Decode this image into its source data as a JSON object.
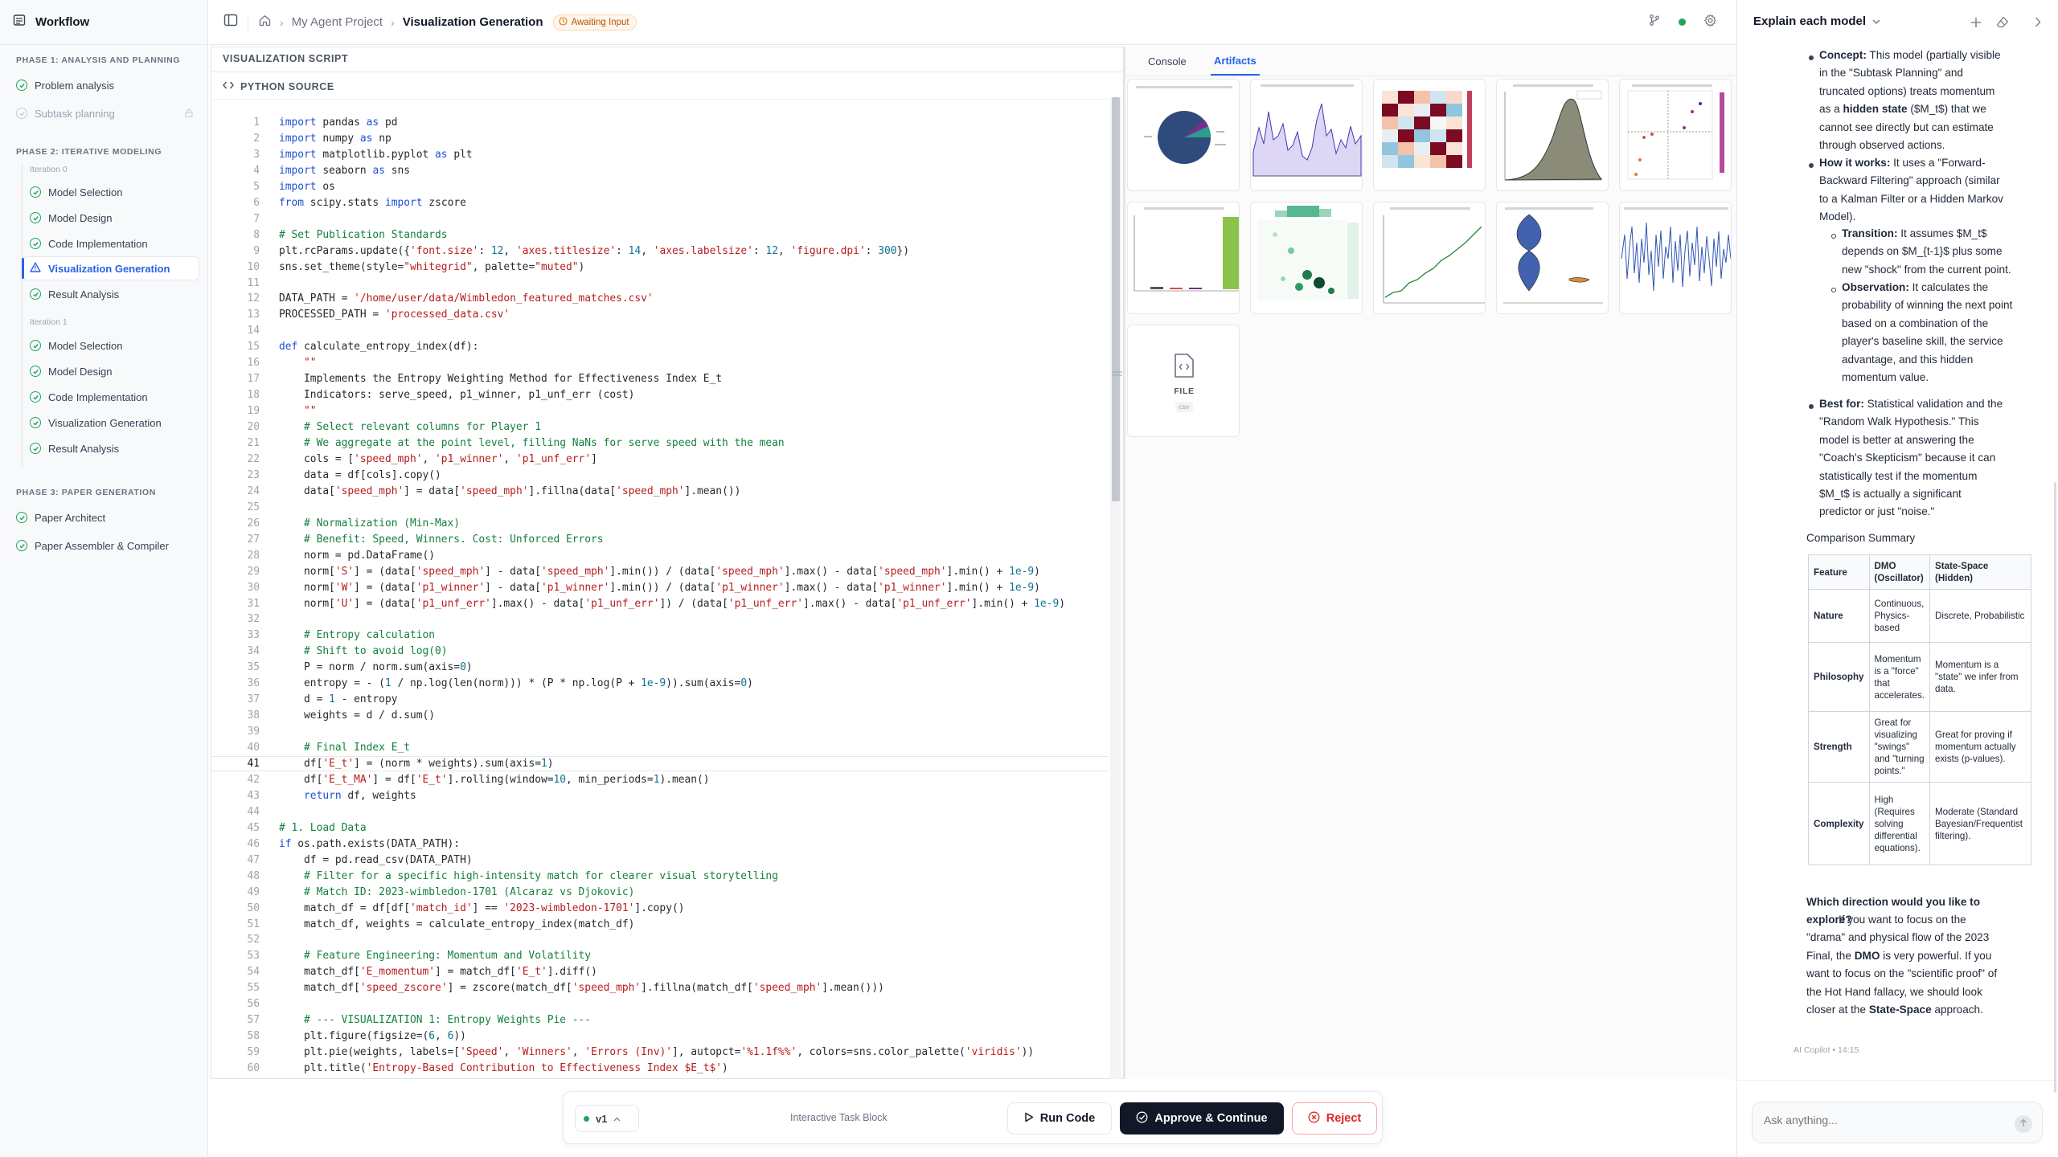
{
  "sidebar": {
    "title": "Workflow",
    "phases": [
      {
        "label": "PHASE 1: ANALYSIS AND PLANNING"
      },
      {
        "label": "PHASE 2: ITERATIVE MODELING"
      },
      {
        "label": "PHASE 3: PAPER GENERATION"
      }
    ],
    "phase1_items": [
      "Problem analysis",
      "Subtask planning"
    ],
    "iteration0_label": "Iteration 0",
    "iteration0_items": [
      "Model Selection",
      "Model Design",
      "Code Implementation",
      "Visualization Generation",
      "Result Analysis"
    ],
    "iteration1_label": "Iteration 1",
    "iteration1_items": [
      "Model Selection",
      "Model Design",
      "Code Implementation",
      "Visualization Generation",
      "Result Analysis"
    ],
    "phase3_items": [
      "Paper Architect",
      "Paper Assembler & Compiler"
    ]
  },
  "breadcrumb": {
    "project": "My Agent Project",
    "current": "Visualization Generation",
    "status": "Awaiting Input"
  },
  "editor": {
    "section_title": "VISUALIZATION SCRIPT",
    "source_label": "PYTHON SOURCE"
  },
  "code_lines": [
    "import pandas as pd",
    "import numpy as np",
    "import matplotlib.pyplot as plt",
    "import seaborn as sns",
    "import os",
    "from scipy.stats import zscore",
    "",
    "# Set Publication Standards",
    "plt.rcParams.update({'font.size': 12, 'axes.titlesize': 14, 'axes.labelsize': 12, 'figure.dpi': 300})",
    "sns.set_theme(style=\"whitegrid\", palette=\"muted\")",
    "",
    "DATA_PATH = '/home/user/data/Wimbledon_featured_matches.csv'",
    "PROCESSED_PATH = 'processed_data.csv'",
    "",
    "def calculate_entropy_index(df):",
    "    \"\"\"",
    "    Implements the Entropy Weighting Method for Effectiveness Index E_t",
    "    Indicators: serve_speed, p1_winner, p1_unf_err (cost)",
    "    \"\"\"",
    "    # Select relevant columns for Player 1",
    "    # We aggregate at the point level, filling NaNs for serve speed with the mean",
    "    cols = ['speed_mph', 'p1_winner', 'p1_unf_err']",
    "    data = df[cols].copy()",
    "    data['speed_mph'] = data['speed_mph'].fillna(data['speed_mph'].mean())",
    "",
    "    # Normalization (Min-Max)",
    "    # Benefit: Speed, Winners. Cost: Unforced Errors",
    "    norm = pd.DataFrame()",
    "    norm['S'] = (data['speed_mph'] - data['speed_mph'].min()) / (data['speed_mph'].max() - data['speed_mph'].min() + 1e-9)",
    "    norm['W'] = (data['p1_winner'] - data['p1_winner'].min()) / (data['p1_winner'].max() - data['p1_winner'].min() + 1e-9)",
    "    norm['U'] = (data['p1_unf_err'].max() - data['p1_unf_err']) / (data['p1_unf_err'].max() - data['p1_unf_err'].min() + 1e-9)",
    "",
    "    # Entropy calculation",
    "    # Shift to avoid log(0)",
    "    P = norm / norm.sum(axis=0)",
    "    entropy = - (1 / np.log(len(norm))) * (P * np.log(P + 1e-9)).sum(axis=0)",
    "    d = 1 - entropy",
    "    weights = d / d.sum()",
    "",
    "    # Final Index E_t",
    "    df['E_t'] = (norm * weights).sum(axis=1)",
    "    df['E_t_MA'] = df['E_t'].rolling(window=10, min_periods=1).mean()",
    "    return df, weights",
    "",
    "# 1. Load Data",
    "if os.path.exists(DATA_PATH):",
    "    df = pd.read_csv(DATA_PATH)",
    "    # Filter for a specific high-intensity match for clearer visual storytelling",
    "    # Match ID: 2023-wimbledon-1701 (Alcaraz vs Djokovic)",
    "    match_df = df[df['match_id'] == '2023-wimbledon-1701'].copy()",
    "    match_df, weights = calculate_entropy_index(match_df)",
    "",
    "    # Feature Engineering: Momentum and Volatility",
    "    match_df['E_momentum'] = match_df['E_t'].diff()",
    "    match_df['speed_zscore'] = zscore(match_df['speed_mph'].fillna(match_df['speed_mph'].mean()))",
    "",
    "    # --- VISUALIZATION 1: Entropy Weights Pie ---",
    "    plt.figure(figsize=(6, 6))",
    "    plt.pie(weights, labels=['Speed', 'Winners', 'Errors (Inv)'], autopct='%1.1f%%', colors=sns.color_palette('viridis'))",
    "    plt.title('Entropy-Based Contribution to Effectiveness Index $E_t$')"
  ],
  "artifacts": {
    "tabs": [
      "Console",
      "Artifacts"
    ],
    "active_tab": "Artifacts",
    "file_label": "FILE",
    "file_ext": "csv"
  },
  "chat": {
    "title": "Explain each model",
    "concept_label": "Concept:",
    "concept_text_1": " This model (partially visible",
    "concept_text_2": "in the \"Subtask Planning\" and",
    "concept_text_3": "truncated options) treats momentum",
    "concept_text_4a": "as a ",
    "concept_text_4b": "hidden state",
    "concept_text_4c": " ($M_t$) that we",
    "concept_text_5": "cannot see directly but can estimate",
    "concept_text_6": "through observed actions.",
    "how_label": "How it works:",
    "how_text_1": " It uses a \"Forward-",
    "how_text_2": "Backward Filtering\" approach (similar",
    "how_text_3": "to a Kalman Filter or a Hidden Markov",
    "how_text_4": "Model).",
    "transition_label": "Transition:",
    "transition_1": " It assumes $M_t$",
    "transition_2": "depends on $M_{t-1}$ plus some",
    "transition_3": "new \"shock\" from the current point.",
    "observation_label": "Observation:",
    "observation_1": " It calculates the",
    "observation_2": "probability of winning the next point",
    "observation_3": "based on a combination of the",
    "observation_4": "player's baseline skill, the service",
    "observation_5": "advantage, and this hidden",
    "observation_6": "momentum value.",
    "best_label": "Best for:",
    "best_1": " Statistical validation and the",
    "best_2": "\"Random Walk Hypothesis.\" This",
    "best_3": "model is better at answering the",
    "best_4": "\"Coach's Skepticism\" because it can",
    "best_5": "statistically test if the momentum",
    "best_6": "$M_t$ is actually a significant",
    "best_7": "predictor or just \"noise.\"",
    "comparison_title": "Comparison Summary",
    "table_headers": [
      "Feature",
      "DMO (Oscillator)",
      "State-Space (Hidden)"
    ],
    "table_rows": [
      [
        "Nature",
        "Continuous, Physics-based",
        "Discrete, Probabilistic"
      ],
      [
        "Philosophy",
        "Momentum is a \"force\" that accelerates.",
        "Momentum is a \"state\" we infer from data."
      ],
      [
        "Strength",
        "Great for visualizing \"swings\" and \"turning points.\"",
        "Great for proving if momentum actually exists (p-values)."
      ],
      [
        "Complexity",
        "High (Requires solving differential equations).",
        "Moderate (Standard Bayesian/Frequentist filtering)."
      ]
    ],
    "direction_bold": "Which direction would you like to explore?",
    "direction_1": " If you want to focus on the",
    "direction_2": "\"drama\" and physical flow of the 2023",
    "direction_3a": "Final, the ",
    "direction_3b": "DMO",
    "direction_3c": " is very powerful. If you",
    "direction_4": "want to focus on the \"scientific proof\" of",
    "direction_5": "the Hot Hand fallacy, we should look",
    "direction_6a": "closer at the ",
    "direction_6b": "State-Space",
    "direction_6c": " approach.",
    "meta": "AI Copilot • 14:15",
    "input_placeholder": "Ask anything..."
  },
  "task_block": {
    "version": "v1",
    "label": "Interactive Task Block",
    "run": "Run Code",
    "approve": "Approve & Continue",
    "reject": "Reject"
  },
  "colors": {
    "accent": "#2563eb",
    "success": "#22a55a",
    "warning": "#d97706",
    "danger": "#dc2626",
    "dark": "#111827"
  }
}
